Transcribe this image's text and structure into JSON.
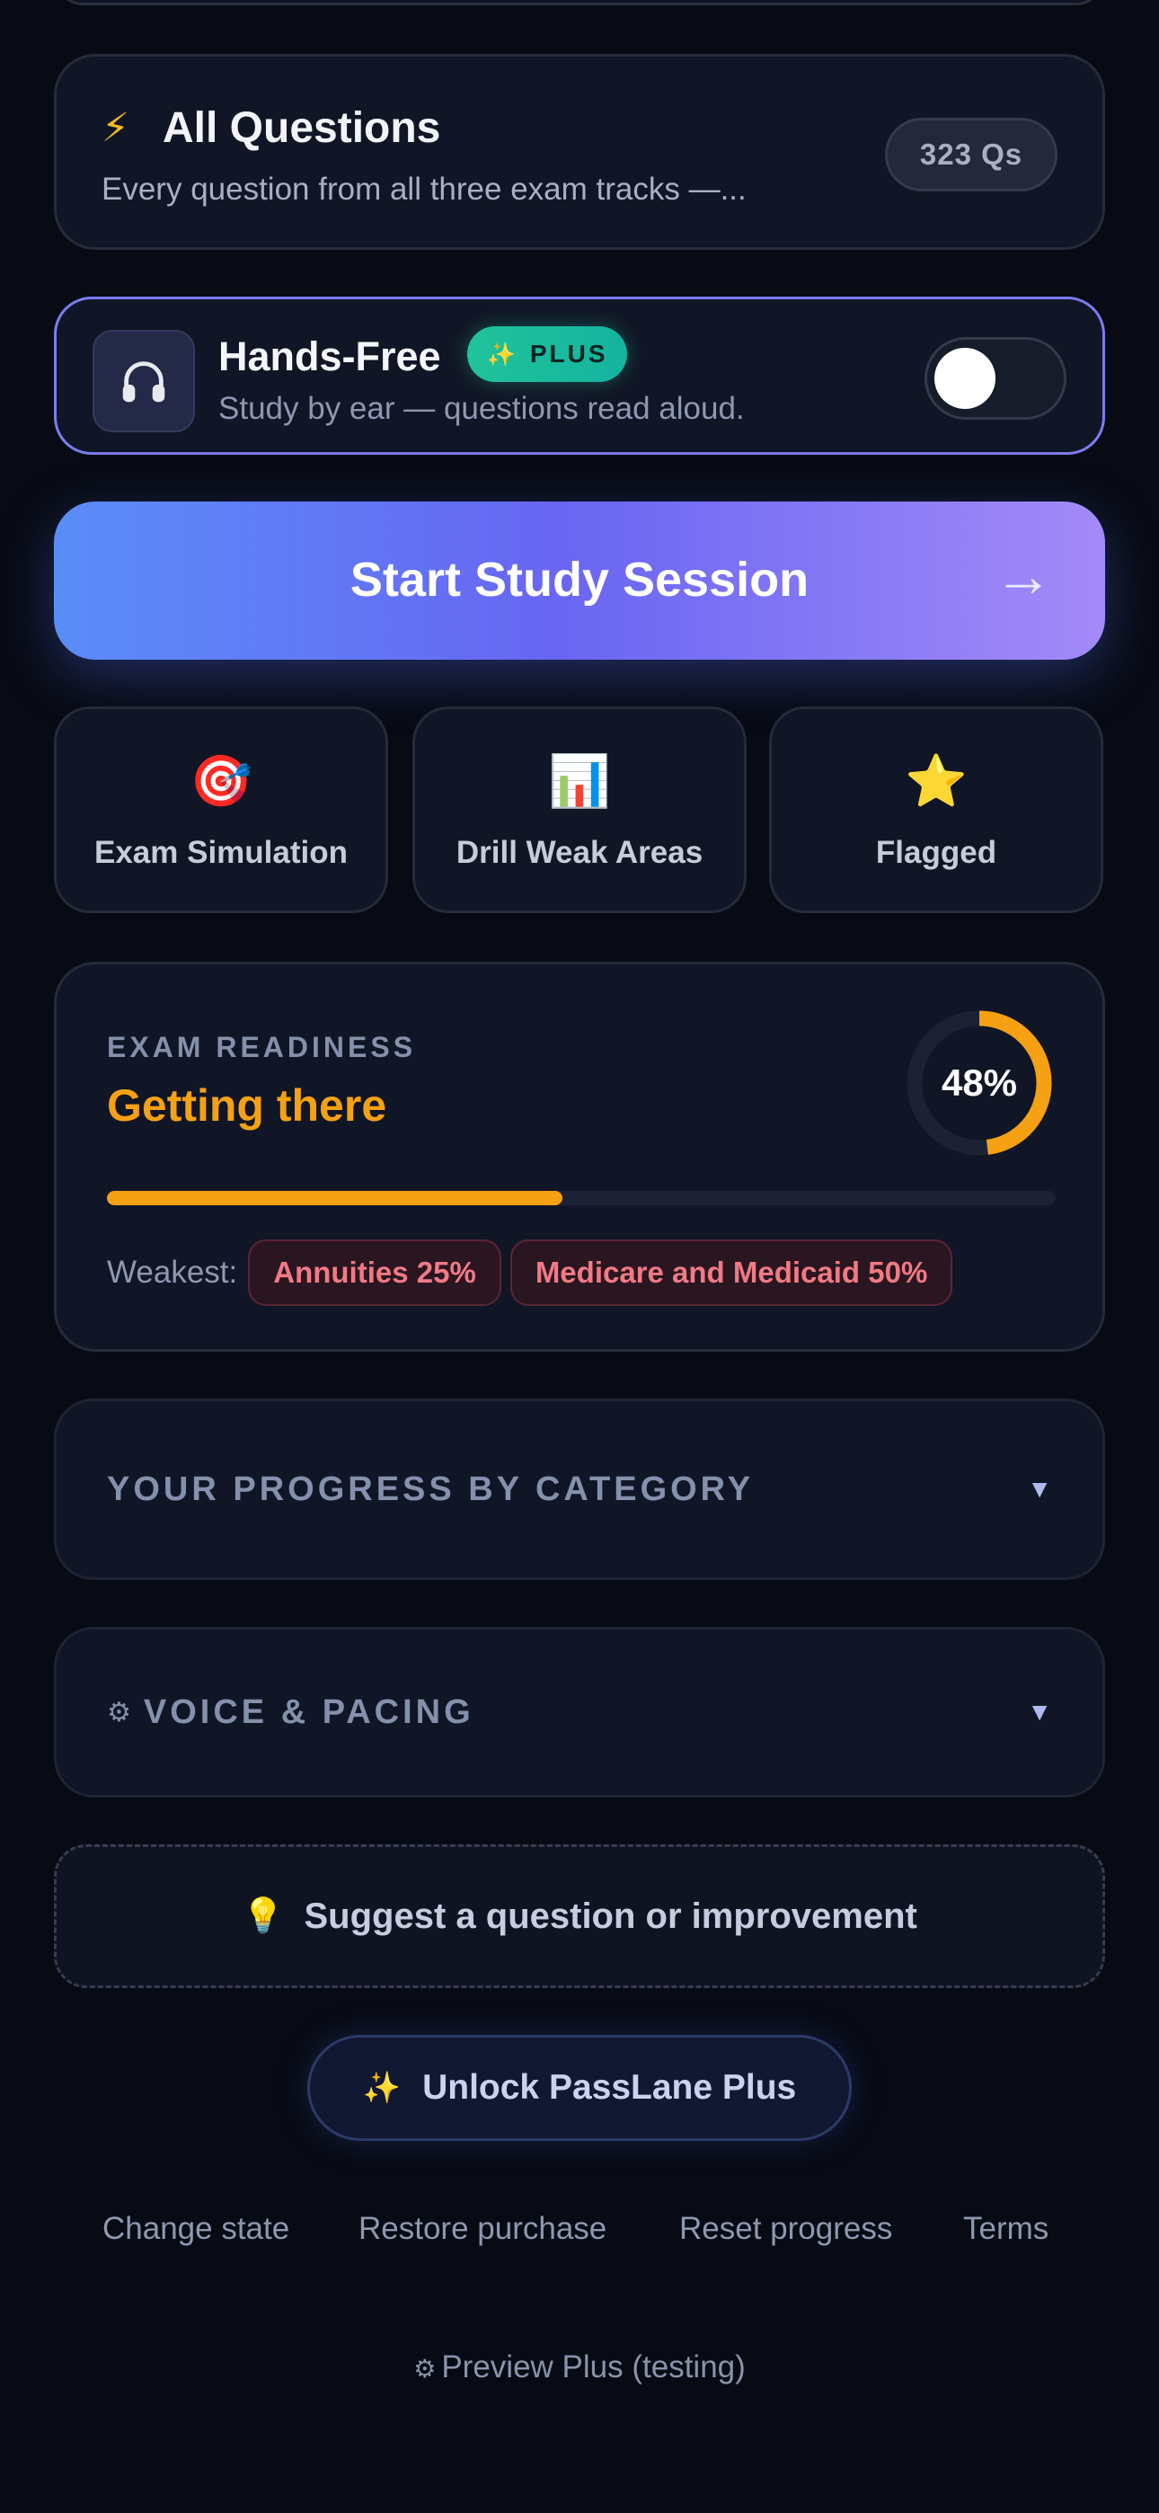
{
  "all_questions": {
    "icon": "lightning-bolt-icon",
    "title": "All Questions",
    "description": "Every question from all three exam tracks —...",
    "count": "323 Qs"
  },
  "hands_free": {
    "icon": "headphones-icon",
    "title": "Hands-Free",
    "badge": "PLUS",
    "subtitle": "Study by ear — questions read aloud.",
    "toggle_on": false
  },
  "start_button": {
    "label": "Start Study Session",
    "arrow": "→"
  },
  "modes": [
    {
      "icon": "target-icon",
      "emoji": "🎯",
      "label": "Exam Simulation"
    },
    {
      "icon": "bar-chart-icon",
      "emoji": "📊",
      "label": "Drill Weak Areas"
    },
    {
      "icon": "star-icon",
      "emoji": "⭐",
      "label": "Flagged"
    }
  ],
  "readiness": {
    "kicker": "EXAM READINESS",
    "status": "Getting there",
    "percent_label": "48%",
    "percent": 48,
    "weakest_label": "Weakest:",
    "weak_areas": [
      "Annuities 25%",
      "Medicare and Medicaid 50%"
    ]
  },
  "progress_section": {
    "title": "YOUR PROGRESS BY CATEGORY",
    "caret": "▼"
  },
  "voice_section": {
    "icon": "gear-icon",
    "title": "VOICE & PACING",
    "caret": "▼"
  },
  "suggest": {
    "icon": "lightbulb-icon",
    "label": "Suggest a question or improvement"
  },
  "unlock": {
    "icon": "sparkles-icon",
    "label": "Unlock PassLane Plus"
  },
  "footer_links": [
    "Change state",
    "Restore purchase",
    "Reset progress",
    "Terms"
  ],
  "preview": {
    "icon": "gear-icon",
    "label": "Preview Plus (testing)"
  },
  "colors": {
    "accent_orange": "#f5a113",
    "accent_purple": "#7c7cf0",
    "plus_green": "#20c39a",
    "danger": "#f07a85"
  }
}
